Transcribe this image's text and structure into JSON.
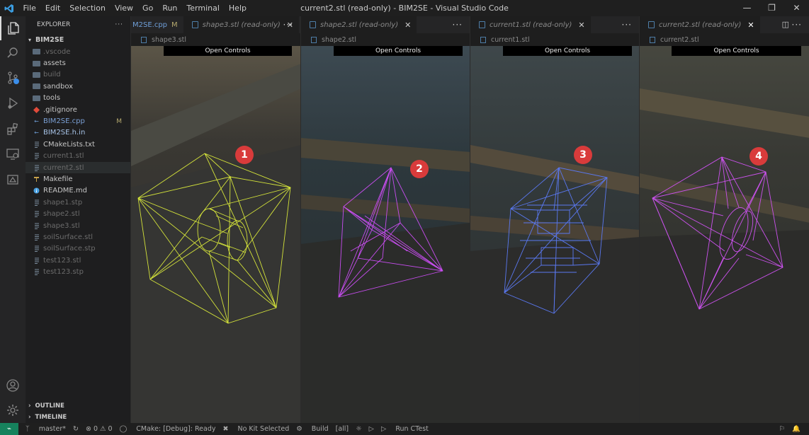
{
  "titlebar": {
    "menu": [
      "File",
      "Edit",
      "Selection",
      "View",
      "Go",
      "Run",
      "Terminal",
      "Help"
    ],
    "title": "current2.stl (read-only) - BIM2SE - Visual Studio Code"
  },
  "sidebar": {
    "header": "EXPLORER",
    "root": "BIM2SE",
    "items": [
      {
        "label": ".vscode",
        "type": "folder",
        "dim": true
      },
      {
        "label": "assets",
        "type": "folder"
      },
      {
        "label": "build",
        "type": "folder",
        "dim": true
      },
      {
        "label": "sandbox",
        "type": "folder"
      },
      {
        "label": "tools",
        "type": "folder"
      },
      {
        "label": ".gitignore",
        "type": "git",
        "dim": false
      },
      {
        "label": "BIM2SE.cpp",
        "type": "cpp",
        "badge": "M",
        "color": "#7a9fd4"
      },
      {
        "label": "BIM2SE.h.in",
        "type": "cpp"
      },
      {
        "label": "CMakeLists.txt",
        "type": "text"
      },
      {
        "label": "current1.stl",
        "type": "text",
        "dim": true
      },
      {
        "label": "current2.stl",
        "type": "text",
        "dim": true,
        "selected": true
      },
      {
        "label": "Makefile",
        "type": "make"
      },
      {
        "label": "README.md",
        "type": "info"
      },
      {
        "label": "shape1.stp",
        "type": "text",
        "dim": true
      },
      {
        "label": "shape2.stl",
        "type": "text",
        "dim": true
      },
      {
        "label": "shape3.stl",
        "type": "text",
        "dim": true
      },
      {
        "label": "soilSurface.stl",
        "type": "text",
        "dim": true
      },
      {
        "label": "soilSurface.stp",
        "type": "text",
        "dim": true
      },
      {
        "label": "test123.stl",
        "type": "text",
        "dim": true
      },
      {
        "label": "test123.stp",
        "type": "text",
        "dim": true
      }
    ],
    "outline": "OUTLINE",
    "timeline": "TIMELINE"
  },
  "groups": [
    {
      "tab1": "M2SE.cpp",
      "tab1_badge": "M",
      "tab2": "shape3.stl (read-only)",
      "crumb": "shape3.stl",
      "marker": "1",
      "color": "#d4e33a"
    },
    {
      "tab1": "shape2.stl (read-only)",
      "crumb": "shape2.stl",
      "marker": "2",
      "color": "#c84df0"
    },
    {
      "tab1": "current1.stl (read-only)",
      "crumb": "current1.stl",
      "marker": "3",
      "color": "#5a78f0"
    },
    {
      "tab1": "current2.stl (read-only)",
      "crumb": "current2.stl",
      "marker": "4",
      "color": "#cc52ee"
    }
  ],
  "open_controls": "Open Controls",
  "statusbar": {
    "branch": "master*",
    "problems": "⊗ 0 ⚠ 0",
    "cmake": "CMake: [Debug]: Ready",
    "kit": "No Kit Selected",
    "build": "Build",
    "target": "[all]",
    "ctest": "Run CTest"
  }
}
